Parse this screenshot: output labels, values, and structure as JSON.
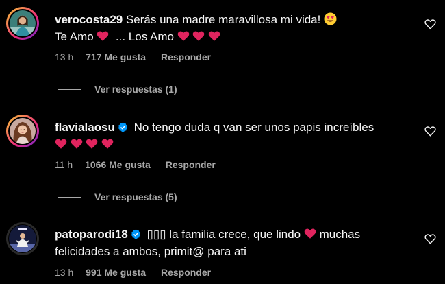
{
  "comments": [
    {
      "username": "verocosta29",
      "verified": false,
      "text_a": "Serás una madre maravillosa mi vida!",
      "line2_a": "Te Amo",
      "line2_b": "... Los Amo",
      "time": "13 h",
      "likes": "717 Me gusta",
      "reply": "Responder",
      "replies": "Ver respuestas (1)"
    },
    {
      "username": "flavialaosu",
      "verified": true,
      "text_a": "No tengo duda q van ser unos papis increíbles",
      "time": "11 h",
      "likes": "1066 Me gusta",
      "reply": "Responder",
      "replies": "Ver respuestas (5)"
    },
    {
      "username": "patoparodi18",
      "verified": true,
      "boxes": "▯▯▯",
      "text_a": "la familia crece, que lindo",
      "text_b": "muchas",
      "line2_a": "felicidades a ambos, primit@ para ati",
      "time": "13 h",
      "likes": "991 Me gusta",
      "reply": "Responder"
    }
  ],
  "colors": {
    "background": "#000000",
    "text": "#f5f5f5",
    "muted": "#a8a8a8",
    "heart": "#e0245e",
    "verified": "#0095f6"
  }
}
